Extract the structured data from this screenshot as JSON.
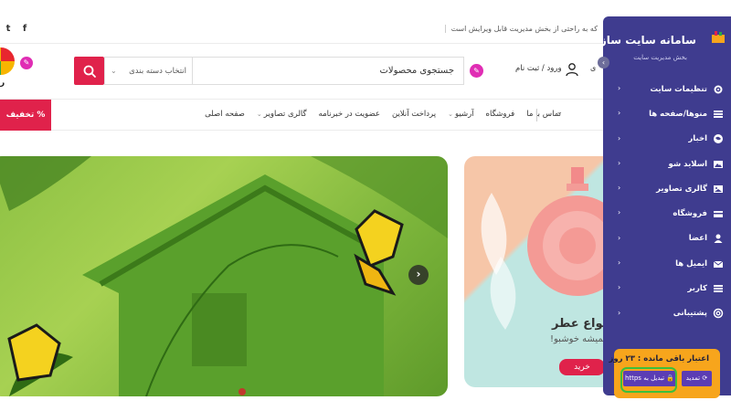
{
  "topbar": {
    "social": [
      "f",
      "t"
    ],
    "notice": "که به راحتی از بخش مدیریت قابل ویرایش است"
  },
  "header": {
    "logo_letter": "ر",
    "category_select": "انتخاب دسته بندی",
    "search_placeholder": "جستجوی محصولات",
    "login": "ورود / ثبت نام",
    "extra": "ی"
  },
  "nav": {
    "offer": "% تخفیف",
    "items": [
      {
        "label": "صفحه اصلی",
        "caret": false
      },
      {
        "label": "گالری تصاویر",
        "caret": true
      },
      {
        "label": "عضویت در خبرنامه",
        "caret": false
      },
      {
        "label": "پرداخت آنلاین",
        "caret": false
      },
      {
        "label": "آرشیو",
        "caret": true
      },
      {
        "label": "فروشگاه",
        "caret": false
      },
      {
        "label": "تماس با ما",
        "caret": false
      }
    ]
  },
  "banner": {
    "side_title": "انواع عطر",
    "side_subtitle": "همیشه خوشبو!",
    "buy": "خرید"
  },
  "panel": {
    "title": "سامانه سایت ساز",
    "subtitle": "بخش مدیریت سایت",
    "menu": [
      {
        "label": "تنظیمات سایت",
        "icon": "settings-icon"
      },
      {
        "label": "منوها/صفحه ها",
        "icon": "menu-icon"
      },
      {
        "label": "اخبار",
        "icon": "news-icon"
      },
      {
        "label": "اسلاید شو",
        "icon": "slideshow-icon"
      },
      {
        "label": "گالری تصاویر",
        "icon": "gallery-icon"
      },
      {
        "label": "فروشگاه",
        "icon": "shop-icon"
      },
      {
        "label": "اعضا",
        "icon": "members-icon"
      },
      {
        "label": "ایمیل ها",
        "icon": "email-icon"
      },
      {
        "label": "کاربر",
        "icon": "user-list-icon"
      },
      {
        "label": "پشتیبانی",
        "icon": "support-icon"
      }
    ],
    "credit": "اعتبار باقی مانده : ۲۳ روز",
    "renew": "تمدید",
    "https": "تبدیل به https"
  },
  "colors": {
    "panel_bg": "#3f3c8f",
    "accent_red": "#e0224b",
    "credit_orange": "#f7a51c",
    "button_purple": "#5b3db4"
  }
}
